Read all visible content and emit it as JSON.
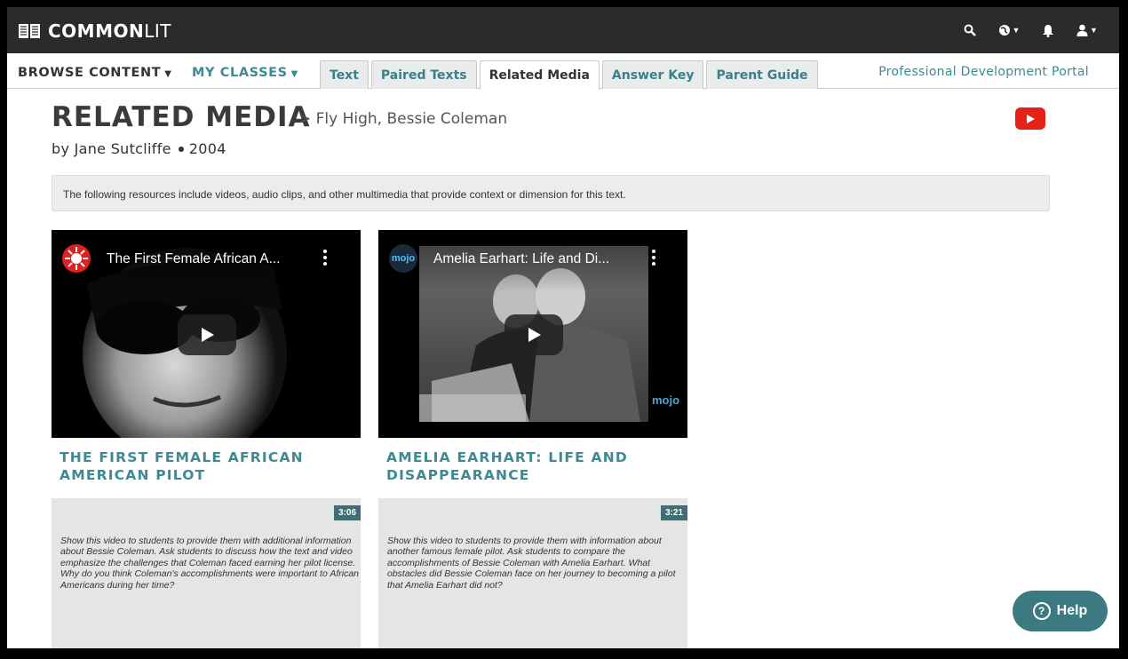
{
  "brand": {
    "name_bold": "COMMON",
    "name_light": "LIT"
  },
  "nav": {
    "browse_content": "BROWSE CONTENT",
    "my_classes": "MY CLASSES",
    "tabs": [
      {
        "label": "Text"
      },
      {
        "label": "Paired Texts"
      },
      {
        "label": "Related Media"
      },
      {
        "label": "Answer Key"
      },
      {
        "label": "Parent Guide"
      }
    ],
    "active_tab": "Related Media",
    "pd_portal": "Professional Development Portal"
  },
  "header_icons": [
    "search-icon",
    "globe-icon",
    "bell-icon",
    "user-icon"
  ],
  "page": {
    "title": "RELATED MEDIA",
    "subtitle": "> Fly High, Bessie Coleman",
    "author": "by Jane Sutcliffe",
    "year": "2004",
    "info": "The following resources include videos, audio clips, and other multimedia that provide context or dimension for this text."
  },
  "cards": [
    {
      "video_title": "The First Female African A...",
      "title_line1": "THE FIRST FEMALE AFRICAN",
      "title_line2": "AMERICAN PILOT",
      "duration": "3:06",
      "description": "Show this video to students to provide them with additional information about Bessie Coleman. Ask students to discuss how the text and video emphasize the challenges that Coleman faced earning her pilot license. Why do you think Coleman's accomplishments were important to African Americans during her time?"
    },
    {
      "video_title": "Amelia Earhart: Life and Di...",
      "channel_label": "mojo",
      "watermark": "mojo",
      "title_line1": "AMELIA EARHART: LIFE AND",
      "title_line2": "DISAPPEARANCE",
      "duration": "3:21",
      "description": "Show this video to students to provide them with information about another famous female pilot. Ask students to compare the accomplishments of Bessie Coleman with Amelia Earhart. What obstacles did Bessie Coleman face on her journey to becoming a pilot that Amelia Earhart did not?"
    }
  ],
  "help": {
    "label": "Help"
  },
  "colors": {
    "teal": "#3b8a94",
    "topbar": "#2b2b2b",
    "youtube_red": "#e62117",
    "help_bg": "#3c7a82"
  }
}
